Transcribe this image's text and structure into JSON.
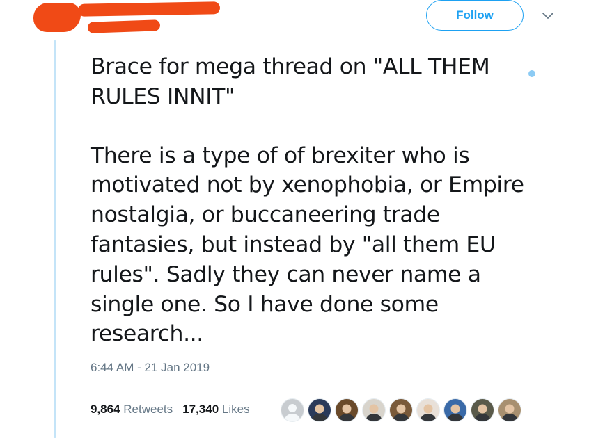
{
  "header": {
    "follow_label": "Follow",
    "menu_icon": "chevron-down-icon"
  },
  "tweet": {
    "paragraphs": [
      "Brace for mega thread on \"ALL THEM\nRULES INNIT\"",
      "There is a type of of brexiter who is\nmotivated not by xenophobia, or Empire\nnostalgia, or buccaneering trade\nfantasies, but instead by \"all them EU\nrules\". Sadly they can never name a\nsingle one. So I have done some\nresearch..."
    ],
    "timestamp": "6:44 AM - 21 Jan 2019"
  },
  "stats": {
    "retweets_count": "9,864",
    "retweets_label": "Retweets",
    "likes_count": "17,340",
    "likes_label": "Likes"
  },
  "likers": [
    {
      "name": "default-avatar",
      "bg": "#c8ccd0"
    },
    {
      "name": "avatar-2",
      "bg": "#2a3a5a"
    },
    {
      "name": "avatar-3",
      "bg": "#6a4a2a"
    },
    {
      "name": "avatar-4",
      "bg": "#d8d4cc"
    },
    {
      "name": "avatar-5",
      "bg": "#7a5a3a"
    },
    {
      "name": "avatar-6",
      "bg": "#e8e0d8"
    },
    {
      "name": "avatar-7",
      "bg": "#3a6aa8"
    },
    {
      "name": "avatar-8",
      "bg": "#5a5a4a"
    },
    {
      "name": "avatar-9",
      "bg": "#a89070"
    }
  ],
  "colors": {
    "accent": "#1da1f2",
    "redaction": "#f04a16",
    "thread_line": "#c4e4f8"
  }
}
